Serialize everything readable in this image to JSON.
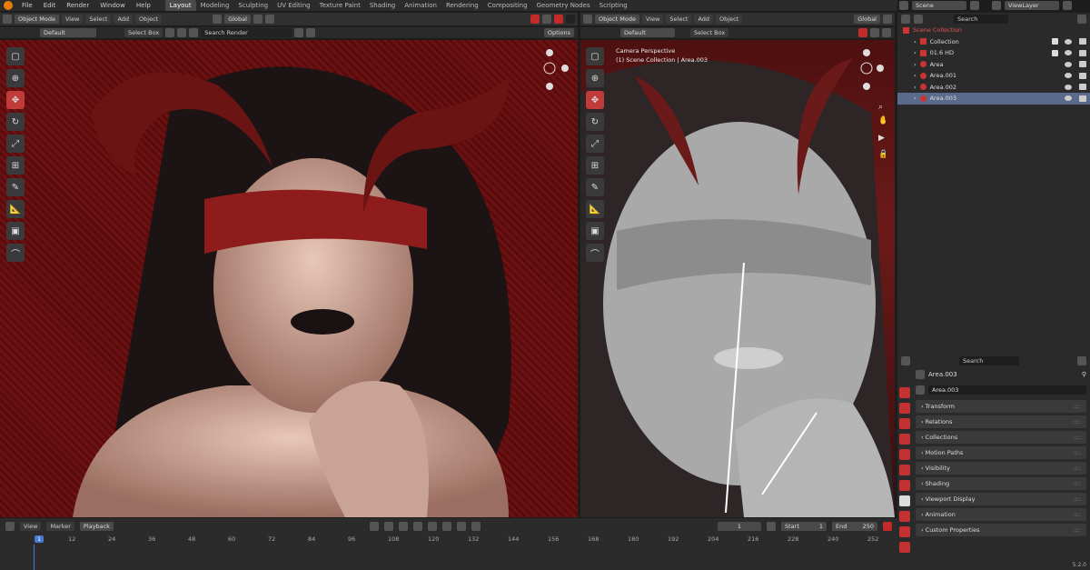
{
  "menu": [
    "File",
    "Edit",
    "Render",
    "Window",
    "Help"
  ],
  "workspaces": [
    {
      "label": "Layout",
      "active": true
    },
    {
      "label": "Modeling"
    },
    {
      "label": "Sculpting"
    },
    {
      "label": "UV Editing"
    },
    {
      "label": "Texture Paint"
    },
    {
      "label": "Shading"
    },
    {
      "label": "Animation"
    },
    {
      "label": "Rendering"
    },
    {
      "label": "Compositing"
    },
    {
      "label": "Geometry Nodes"
    },
    {
      "label": "Scripting"
    }
  ],
  "viewport_left": {
    "mode": "Object Mode",
    "menus": [
      "View",
      "Select",
      "Add",
      "Object"
    ],
    "transform": "Global",
    "orientation": "Default",
    "drag": "Select Box",
    "search_placeholder": "Search Render",
    "options": "Options"
  },
  "viewport_right": {
    "mode": "Object Mode",
    "menus": [
      "View",
      "Select",
      "Add",
      "Object"
    ],
    "transform": "Global",
    "orientation": "Default",
    "drag": "Select Box",
    "label_line1": "Camera Perspective",
    "label_line2": "(1) Scene Collection | Area.003"
  },
  "topright": {
    "scene": "Scene",
    "viewlayer": "ViewLayer"
  },
  "outliner": {
    "search_placeholder": "Search",
    "root": "Scene Collection",
    "rows": [
      {
        "name": "Collection",
        "selected": false
      },
      {
        "name": "01.6 HD",
        "selected": false
      },
      {
        "name": "Area",
        "selected": false
      },
      {
        "name": "Area.001",
        "selected": false
      },
      {
        "name": "Area.002",
        "selected": false
      },
      {
        "name": "Area.003",
        "selected": true
      }
    ]
  },
  "properties": {
    "search_placeholder": "Search",
    "object_name": "Area.003",
    "datablock": "Area.003",
    "panels": [
      "Transform",
      "Relations",
      "Collections",
      "Motion Paths",
      "Visibility",
      "Shading",
      "Viewport Display",
      "Animation",
      "Custom Properties"
    ]
  },
  "timeline": {
    "menus": [
      "View",
      "Marker"
    ],
    "playback": "Playback",
    "current_frame": "1",
    "start_label": "Start",
    "start": "1",
    "end_label": "End",
    "end": "250",
    "ruler_frame": "1",
    "ticks": [
      "12",
      "24",
      "36",
      "48",
      "60",
      "72",
      "84",
      "96",
      "108",
      "120",
      "132",
      "144",
      "156",
      "168",
      "180",
      "192",
      "204",
      "216",
      "228",
      "240",
      "252"
    ]
  },
  "version": "5.2.0",
  "colors": {
    "accent": "#c23b3b",
    "selection": "#5a6a8a",
    "blender_logo": "#e87d0d"
  }
}
